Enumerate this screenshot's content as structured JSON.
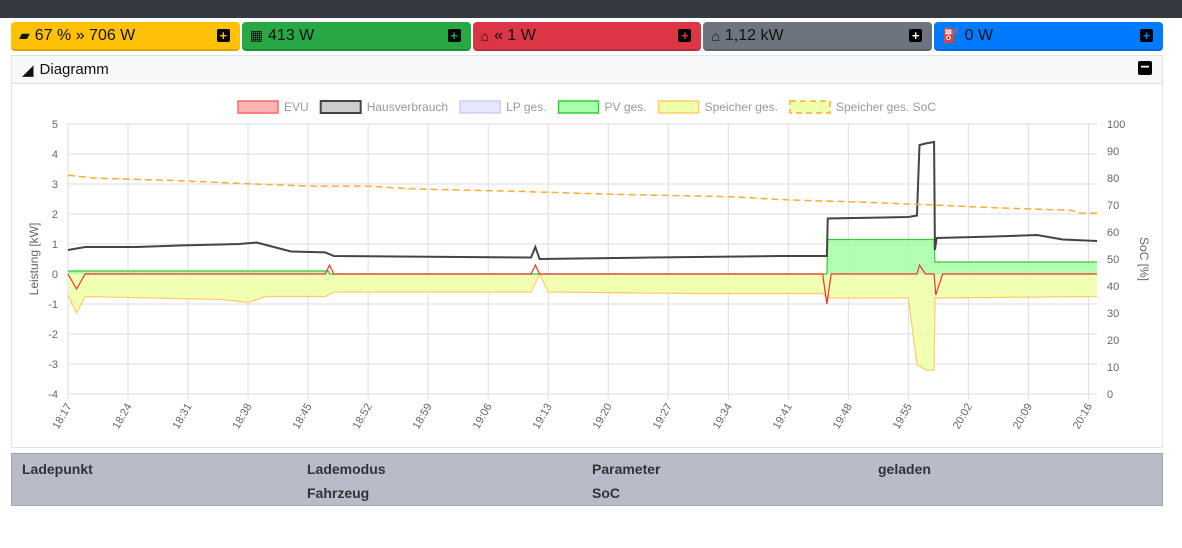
{
  "tiles": [
    {
      "icon": "battery-icon",
      "text": "67 % » 706 W",
      "color": "#ffc107",
      "plus": "#ffc107"
    },
    {
      "icon": "solar-panel-icon",
      "text": "413 W",
      "color": "#28a745",
      "plus": "#28a745"
    },
    {
      "icon": "grid-icon",
      "text": "« 1 W",
      "color": "#dc3545",
      "plus": "#dc3545"
    },
    {
      "icon": "home-icon",
      "text": "1,12 kW",
      "color": "#6c757d",
      "plus": "#fff"
    },
    {
      "icon": "charging-station-icon",
      "text": "0 W",
      "color": "#007bff",
      "plus": "#007bff"
    }
  ],
  "card": {
    "title": "Diagramm"
  },
  "table": {
    "headers": [
      "Ladepunkt",
      "Lademodus",
      "Parameter",
      "geladen"
    ],
    "sub": [
      "Fahrzeug",
      "SoC"
    ]
  },
  "chart_data": {
    "type": "line",
    "ylabel": "Leistung [kW]",
    "y2label": "SoC [%]",
    "ylim": [
      -4,
      5
    ],
    "y2lim": [
      0,
      100
    ],
    "yticks": [
      "5",
      "4",
      "3",
      "2",
      "1",
      "0",
      "-1",
      "-2",
      "-3",
      "-4"
    ],
    "y2ticks": [
      "100",
      "90",
      "80",
      "70",
      "60",
      "50",
      "40",
      "30",
      "20",
      "10",
      "0"
    ],
    "xticks": [
      "18:17",
      "18:24",
      "18:31",
      "18:38",
      "18:45",
      "18:52",
      "18:59",
      "19:06",
      "19:13",
      "19:20",
      "19:27",
      "19:34",
      "19:41",
      "19:48",
      "19:55",
      "20:02",
      "20:09",
      "20:16"
    ],
    "xrange": [
      "18:17",
      "20:17"
    ],
    "legend": [
      {
        "name": "EVU",
        "fill": "#ffb3b3",
        "stroke": "#ff6666"
      },
      {
        "name": "Hausverbrauch",
        "fill": "#cccccc",
        "stroke": "#444444"
      },
      {
        "name": "LP ges.",
        "fill": "#e6e6ff",
        "stroke": "#ccccff"
      },
      {
        "name": "PV ges.",
        "fill": "#aaffaa",
        "stroke": "#33cc33"
      },
      {
        "name": "Speicher ges.",
        "fill": "#eeffaa",
        "stroke": "#ffcc66"
      },
      {
        "name": "Speicher ges. SoC",
        "fill": "#eeffaa",
        "stroke": "#ffaa33",
        "dashed": true
      }
    ],
    "series": {
      "Hausverbrauch": [
        [
          "18:17",
          0.8
        ],
        [
          "18:19",
          0.9
        ],
        [
          "18:25",
          0.9
        ],
        [
          "18:30",
          0.95
        ],
        [
          "18:37",
          1.0
        ],
        [
          "18:39",
          1.05
        ],
        [
          "18:41",
          0.9
        ],
        [
          "18:43",
          0.75
        ],
        [
          "18:47",
          0.72
        ],
        [
          "18:48",
          0.6
        ],
        [
          "19:11",
          0.55
        ],
        [
          "19:11.5",
          0.9
        ],
        [
          "19:12",
          0.5
        ],
        [
          "19:25",
          0.55
        ],
        [
          "19:40",
          0.6
        ],
        [
          "19:45.5",
          0.6
        ],
        [
          "19:45.6",
          1.85
        ],
        [
          "19:55",
          1.9
        ],
        [
          "19:56",
          1.95
        ],
        [
          "19:56.3",
          4.3
        ],
        [
          "19:57",
          4.35
        ],
        [
          "19:58",
          4.4
        ],
        [
          "19:58.1",
          0.8
        ],
        [
          "19:58.3",
          1.2
        ],
        [
          "20:05",
          1.25
        ],
        [
          "20:10",
          1.3
        ],
        [
          "20:13",
          1.15
        ],
        [
          "20:17",
          1.1
        ]
      ],
      "PV ges.": [
        [
          "18:17",
          0.1
        ],
        [
          "18:47.4",
          0.1
        ],
        [
          "18:47.5",
          0
        ],
        [
          "19:45.5",
          0
        ],
        [
          "19:45.6",
          1.15
        ],
        [
          "19:58",
          1.15
        ],
        [
          "19:58.1",
          0.4
        ],
        [
          "20:17",
          0.4
        ]
      ],
      "Speicher ges.": [
        [
          "18:17",
          -0.7
        ],
        [
          "18:18",
          -1.3
        ],
        [
          "18:19",
          -0.75
        ],
        [
          "18:35",
          -0.85
        ],
        [
          "18:38",
          -0.95
        ],
        [
          "18:40",
          -0.75
        ],
        [
          "18:47",
          -0.75
        ],
        [
          "18:48",
          -0.6
        ],
        [
          "19:11",
          -0.6
        ],
        [
          "19:12",
          0
        ],
        [
          "19:13",
          -0.6
        ],
        [
          "19:30",
          -0.65
        ],
        [
          "19:45",
          -0.65
        ],
        [
          "19:45.6",
          -0.8
        ],
        [
          "19:55",
          -0.8
        ],
        [
          "19:56",
          -3.0
        ],
        [
          "19:57",
          -3.2
        ],
        [
          "19:58",
          -3.2
        ],
        [
          "19:58.1",
          -0.8
        ],
        [
          "20:17",
          -0.75
        ]
      ],
      "EVU": [
        [
          "18:17",
          0
        ],
        [
          "18:18",
          -0.5
        ],
        [
          "18:19",
          0
        ],
        [
          "18:47",
          0
        ],
        [
          "18:47.5",
          0.3
        ],
        [
          "18:48",
          0
        ],
        [
          "19:11",
          0
        ],
        [
          "19:11.5",
          0.3
        ],
        [
          "19:12",
          0
        ],
        [
          "19:45",
          0
        ],
        [
          "19:45.5",
          -1.0
        ],
        [
          "19:46",
          0
        ],
        [
          "19:56",
          0
        ],
        [
          "19:56.3",
          0.3
        ],
        [
          "19:57",
          0
        ],
        [
          "19:58",
          0
        ],
        [
          "19:58.2",
          -0.7
        ],
        [
          "19:59",
          0
        ],
        [
          "20:17",
          0
        ]
      ],
      "Speicher ges. SoC": [
        [
          "18:17",
          81
        ],
        [
          "18:20",
          80
        ],
        [
          "18:30",
          79
        ],
        [
          "18:37",
          78
        ],
        [
          "18:45",
          77
        ],
        [
          "18:52",
          77
        ],
        [
          "18:57",
          76
        ],
        [
          "19:10",
          75
        ],
        [
          "19:20",
          74
        ],
        [
          "19:35",
          73
        ],
        [
          "19:40",
          72
        ],
        [
          "19:50",
          71
        ],
        [
          "19:58",
          70
        ],
        [
          "20:05",
          69
        ],
        [
          "20:14",
          68
        ],
        [
          "20:15",
          67
        ],
        [
          "20:17",
          67
        ]
      ]
    }
  }
}
